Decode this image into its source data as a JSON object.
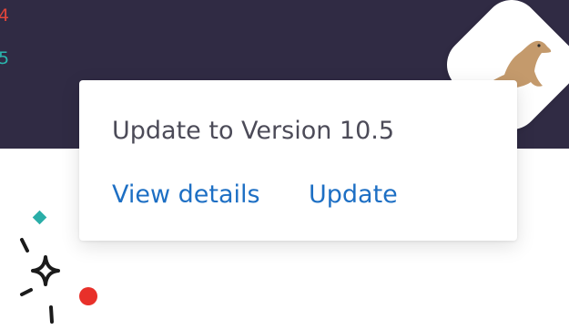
{
  "background": {
    "edge_number_red": "4",
    "edge_number_teal": "5"
  },
  "update_card": {
    "title": "Update to Version 10.5",
    "view_details_label": "View details",
    "update_label": "Update"
  },
  "colors": {
    "banner": "#302b44",
    "link": "#1d6fc4",
    "title_text": "#4c4b58",
    "edge_red": "#e0453a",
    "edge_teal": "#2ab5ad",
    "deco_red": "#e8302a",
    "deco_teal": "#2aaea8",
    "seal": "#c49a6c"
  },
  "icons": {
    "logo": "seal-logo-icon",
    "sparkle": "sparkle-icon"
  }
}
